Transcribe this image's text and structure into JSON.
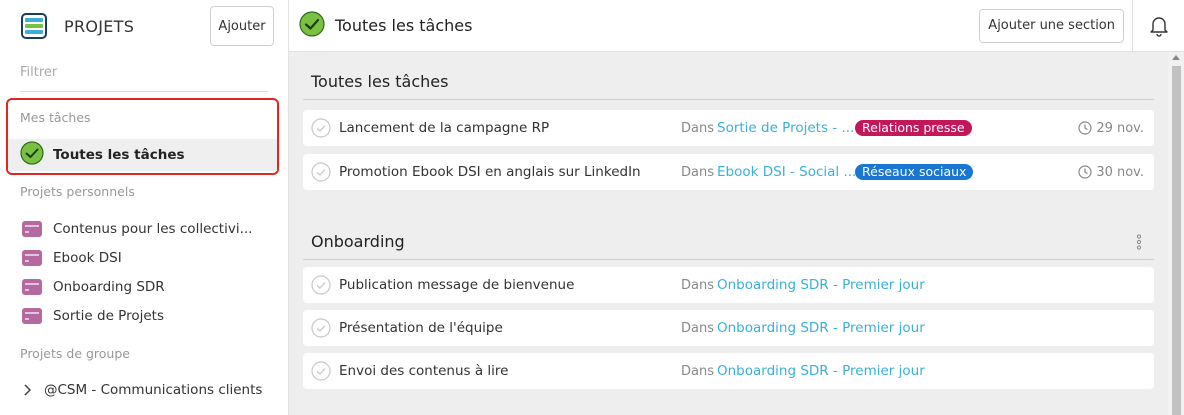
{
  "sidebar": {
    "title": "PROJETS",
    "add_button": "Ajouter",
    "filter_placeholder": "Filtrer",
    "my_tasks_label": "Mes tâches",
    "all_tasks": "Toutes les tâches",
    "personal_label": "Projets personnels",
    "personal_projects": [
      {
        "label": "Contenus pour les collectivi..."
      },
      {
        "label": "Ebook DSI"
      },
      {
        "label": "Onboarding SDR"
      },
      {
        "label": "Sortie de Projets"
      }
    ],
    "group_label": "Projets de groupe",
    "group_projects": [
      {
        "label": "@CSM - Communications clients"
      }
    ]
  },
  "topbar": {
    "title": "Toutes les tâches",
    "add_section_button": "Ajouter une section"
  },
  "sections": [
    {
      "title": "Toutes les tâches",
      "tasks": [
        {
          "name": "Lancement de la campagne RP",
          "in_label": "Dans",
          "project": "Sortie de Projets - ...",
          "tag": "Relations presse",
          "due": "29 nov."
        },
        {
          "name": "Promotion Ebook DSI en anglais sur LinkedIn",
          "in_label": "Dans",
          "project": "Ebook DSI - Social ...",
          "tag": "Réseaux sociaux",
          "due": "30 nov."
        }
      ]
    },
    {
      "title": "Onboarding",
      "tasks": [
        {
          "name": "Publication message de bienvenue",
          "in_label": "Dans",
          "project": "Onboarding SDR - Premier jour"
        },
        {
          "name": "Présentation de l'équipe",
          "in_label": "Dans",
          "project": "Onboarding SDR - Premier jour"
        },
        {
          "name": "Envoi des contenus à lire",
          "in_label": "Dans",
          "project": "Onboarding SDR - Premier jour"
        }
      ]
    }
  ],
  "colors": {
    "accent_green": "#7ac143",
    "link_blue": "#3bb0d6",
    "tag_relations_presse": "#c2185b",
    "tag_reseaux_sociaux": "#1976d2",
    "highlight_red": "#e0261e",
    "project_icon": "#b46a9e"
  }
}
